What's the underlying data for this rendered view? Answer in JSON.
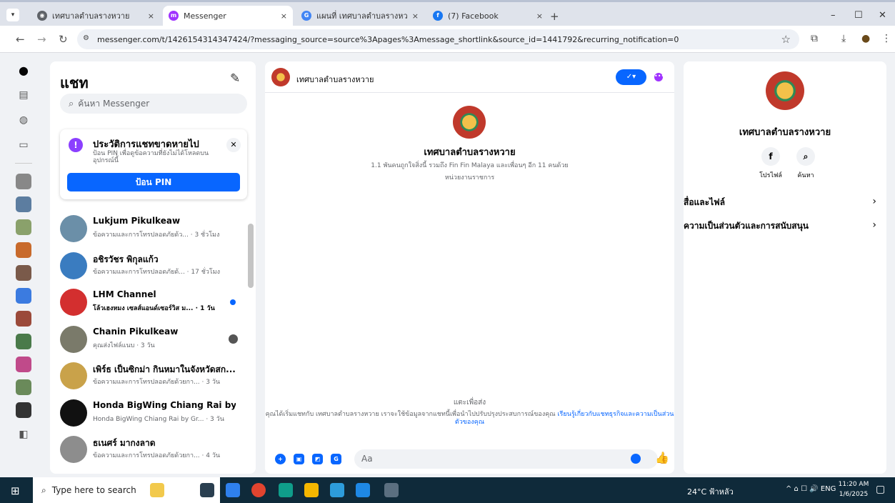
{
  "browser": {
    "tabs": [
      {
        "label": "เทศบาลตำบลรางหวาย",
        "color": "#5f6368"
      },
      {
        "label": "Messenger",
        "color": "#a033ff"
      },
      {
        "label": "แผนที่ เทศบาลตำบลรางหวาย - ค้นห",
        "color": "#4285f4"
      },
      {
        "label": "(7) Facebook",
        "color": "#1877f2"
      }
    ],
    "close_glyph": "×",
    "plus_glyph": "+",
    "window_controls": {
      "minimize": "–",
      "maximize": "☐",
      "close": "✕"
    },
    "url": "messenger.com/t/1426154314347424/?messaging_source=source%3Apages%3Amessage_shortlink&source_id=1441792&recurring_notification=0"
  },
  "left_panel": {
    "title": "แชท",
    "search_placeholder": "ค้นหา Messenger",
    "pin_card": {
      "title": "ประวัติการแชทขาดหายไป",
      "description": "ป้อน PIN เพื่อดูข้อความที่ยังไม่ได้โหลดบนอุปกรณ์นี้",
      "button": "ป้อน PIN"
    },
    "conversations": [
      {
        "name": "Lukjum Pikulkeaw",
        "preview": "ข้อความและการโทรปลอดภัยด้ว... · 3 ชั่วโมง",
        "unread": false,
        "color": "#6b8fa8"
      },
      {
        "name": "อชิรวัชร พิกุลแก้ว",
        "preview": "ข้อความและการโทรปลอดภัยด้... · 17 ชั่วโมง",
        "unread": false,
        "color": "#3a7cc0"
      },
      {
        "name": "LHM Channel",
        "preview": "โล้วเฮงหมง เซลส์แอนด์เซอร์วิส ม... · 1 วัน",
        "unread": true,
        "color": "#d32f2f"
      },
      {
        "name": "Chanin Pikulkeaw",
        "preview": "คุณส่งไฟล์แนบ · 3 วัน",
        "unread": false,
        "color": "#7a7a6a"
      },
      {
        "name": "เพิร์ธ เป็นซิกม่า กินหมาในจังหวัดสก...",
        "preview": "ข้อความและการโทรปลอดภัยด้วยกา... · 3 วัน",
        "unread": false,
        "color": "#c9a24a"
      },
      {
        "name": "Honda BigWing Chiang Rai by G...",
        "preview": "Honda BigWing Chiang Rai by Gr... · 3 วัน",
        "unread": false,
        "color": "#111111"
      },
      {
        "name": "ธเนศร์ มากงลาด",
        "preview": "ข้อความและการโทรปลอดภัยด้วยกา... · 4 วัน",
        "unread": false,
        "color": "#8d8d8d"
      }
    ]
  },
  "chat": {
    "header_name": "เทศบาลตำบลรางหวาย",
    "verified": "✓▾",
    "more": "•••",
    "banner_name": "เทศบาลตำบลรางหวาย",
    "banner_stats": "1.1 พันคนถูกใจสิ่งนี้ รวมถึง Fin Fin Malaya และเพื่อนๆ อีก 11 คนด้วย",
    "banner_category": "หน่วยงานราชการ",
    "tap_to_send": "แตะเพื่อส่ง",
    "privacy_note": "คุณได้เริ่มแชทกับ เทศบาลตำบลรางหวาย เราจะใช้ข้อมูลจากแชทนี้เพื่อนำไปปรับปรุงประสบการณ์ของคุณ",
    "privacy_link": "เรียนรู้เกี่ยวกับแชทธุรกิจและความเป็นส่วนตัวของคุณ",
    "composer_placeholder": "Aa"
  },
  "right_panel": {
    "name": "เทศบาลตำบลรางหวาย",
    "actions": [
      {
        "glyph": "f",
        "label": "โปรไฟล์"
      },
      {
        "glyph": "⌕",
        "label": "ค้นหา"
      }
    ],
    "rows": [
      {
        "label": "สื่อและไฟล์",
        "arrow": "›"
      },
      {
        "label": "ความเป็นส่วนตัวและการสนับสนุน",
        "arrow": "›"
      }
    ]
  },
  "taskbar": {
    "search_placeholder": "Type here to search",
    "weather": "24°C ฟ้าหลัว",
    "tray": "^ ⌂ ☐ 🔊 ENG",
    "time": "11:20 AM",
    "date": "1/6/2025"
  },
  "icons": {
    "tab_menu": "chevron-down-icon",
    "compose": "compose-icon",
    "search": "search-icon",
    "like": "thumbs-up-icon"
  }
}
